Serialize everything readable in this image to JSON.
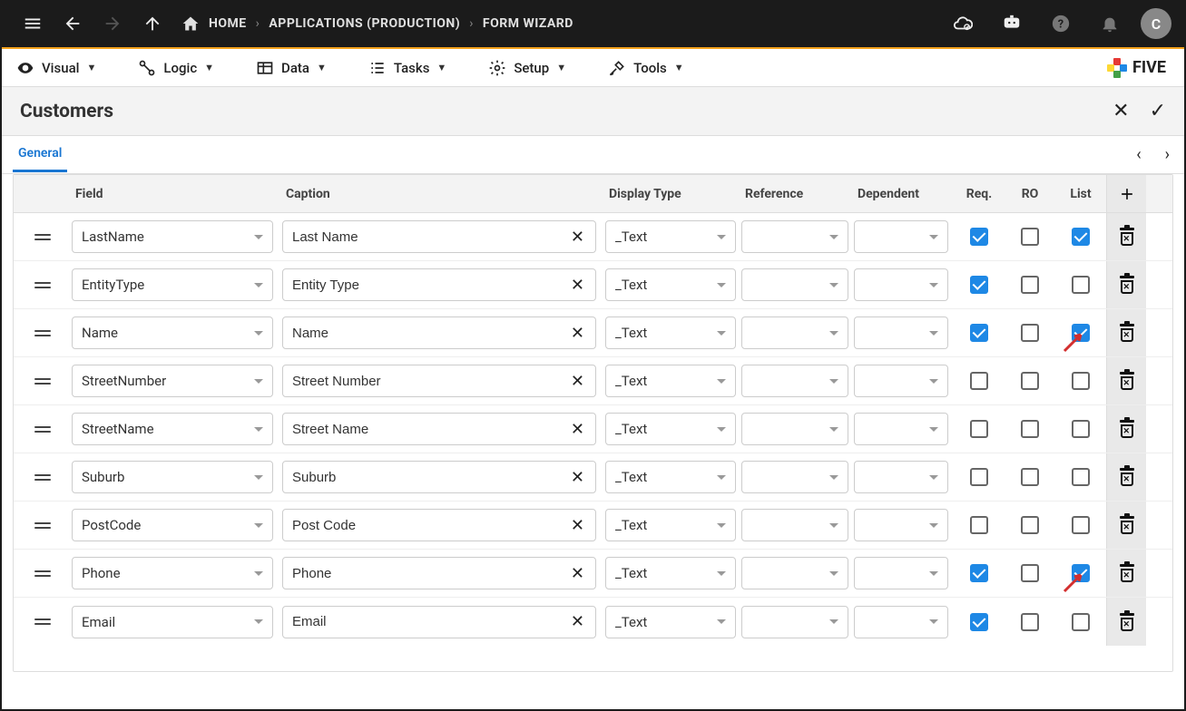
{
  "topbar": {
    "breadcrumbs": [
      "HOME",
      "APPLICATIONS (PRODUCTION)",
      "FORM WIZARD"
    ],
    "avatar_letter": "C"
  },
  "menubar": {
    "items": [
      {
        "label": "Visual"
      },
      {
        "label": "Logic"
      },
      {
        "label": "Data"
      },
      {
        "label": "Tasks"
      },
      {
        "label": "Setup"
      },
      {
        "label": "Tools"
      }
    ],
    "brand": "FIVE"
  },
  "page": {
    "title": "Customers",
    "active_tab": "General"
  },
  "table": {
    "headers": {
      "field": "Field",
      "caption": "Caption",
      "display_type": "Display Type",
      "reference": "Reference",
      "dependent": "Dependent",
      "req": "Req.",
      "ro": "RO",
      "list": "List"
    },
    "rows": [
      {
        "field": "LastName",
        "caption": "Last Name",
        "display": "_Text",
        "ref": "",
        "dep": "",
        "req": true,
        "ro": false,
        "list": true,
        "annot": false
      },
      {
        "field": "EntityType",
        "caption": "Entity Type",
        "display": "_Text",
        "ref": "",
        "dep": "",
        "req": true,
        "ro": false,
        "list": false,
        "annot": false
      },
      {
        "field": "Name",
        "caption": "Name",
        "display": "_Text",
        "ref": "",
        "dep": "",
        "req": true,
        "ro": false,
        "list": true,
        "annot": true
      },
      {
        "field": "StreetNumber",
        "caption": "Street Number",
        "display": "_Text",
        "ref": "",
        "dep": "",
        "req": false,
        "ro": false,
        "list": false,
        "annot": false
      },
      {
        "field": "StreetName",
        "caption": "Street Name",
        "display": "_Text",
        "ref": "",
        "dep": "",
        "req": false,
        "ro": false,
        "list": false,
        "annot": false
      },
      {
        "field": "Suburb",
        "caption": "Suburb",
        "display": "_Text",
        "ref": "",
        "dep": "",
        "req": false,
        "ro": false,
        "list": false,
        "annot": false
      },
      {
        "field": "PostCode",
        "caption": "Post Code",
        "display": "_Text",
        "ref": "",
        "dep": "",
        "req": false,
        "ro": false,
        "list": false,
        "annot": false
      },
      {
        "field": "Phone",
        "caption": "Phone",
        "display": "_Text",
        "ref": "",
        "dep": "",
        "req": true,
        "ro": false,
        "list": true,
        "annot": true
      },
      {
        "field": "Email",
        "caption": "Email",
        "display": "_Text",
        "ref": "",
        "dep": "",
        "req": true,
        "ro": false,
        "list": false,
        "annot": false
      }
    ]
  }
}
